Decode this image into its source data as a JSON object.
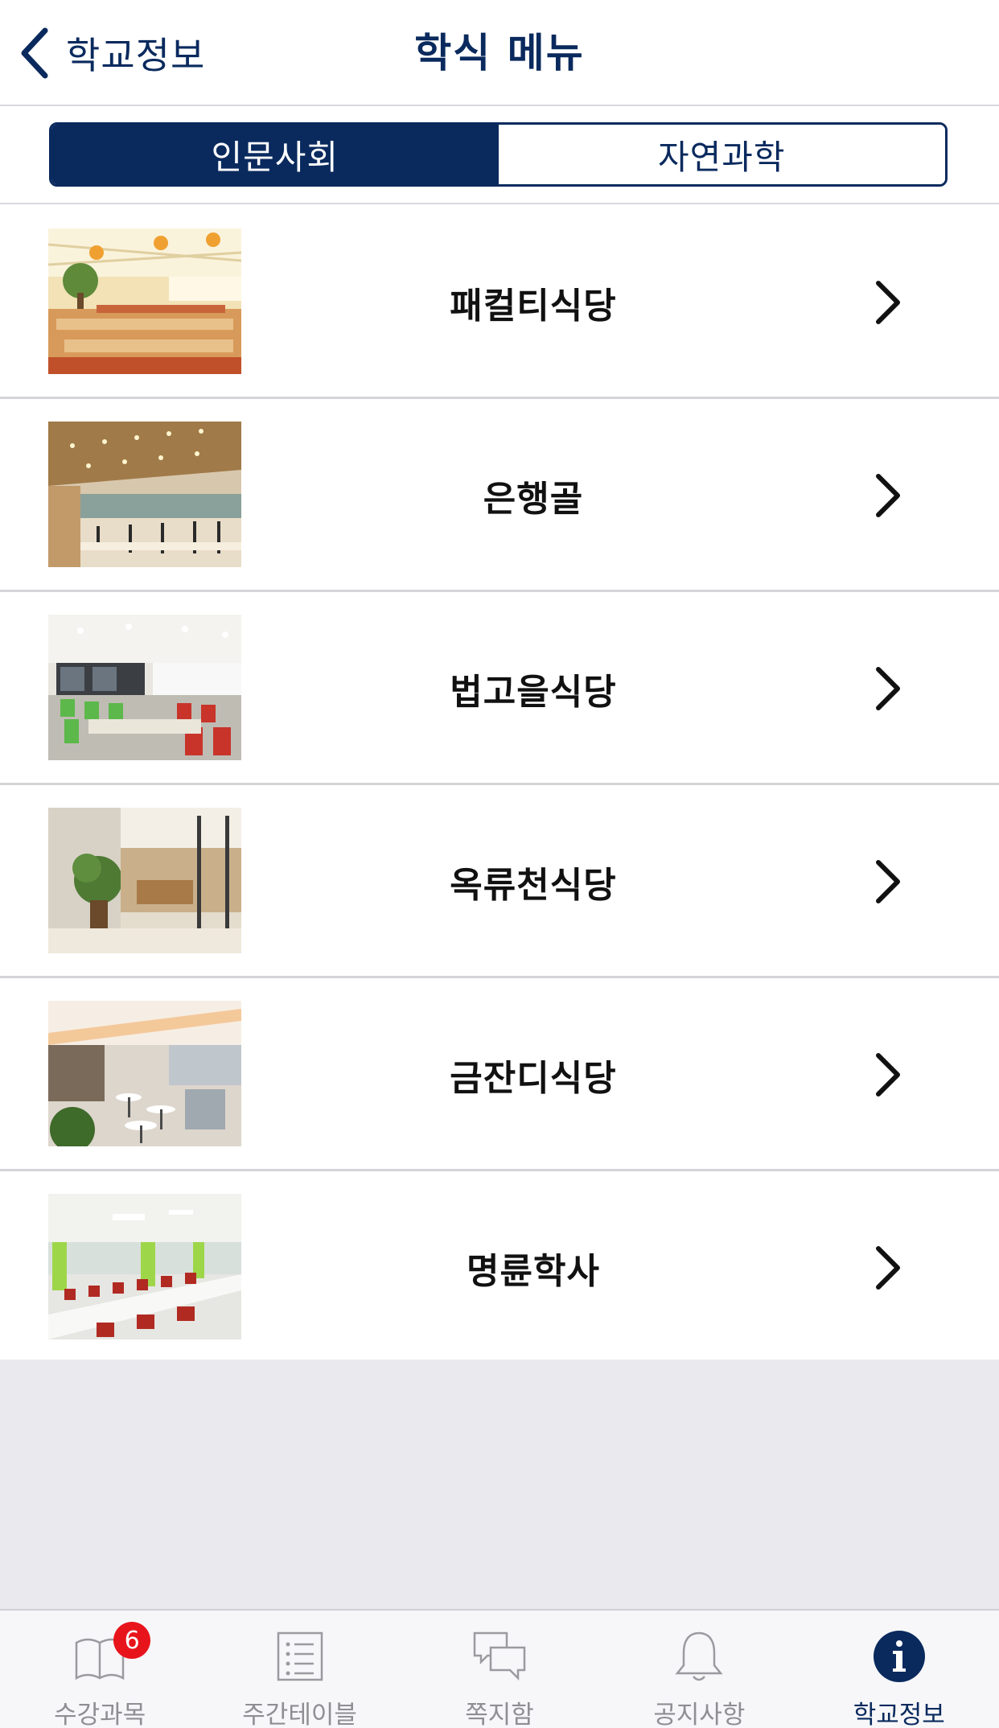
{
  "header": {
    "back_label": "학교정보",
    "title": "학식 메뉴"
  },
  "segments": [
    {
      "label": "인문사회",
      "selected": true
    },
    {
      "label": "자연과학",
      "selected": false
    }
  ],
  "restaurants": [
    {
      "name": "패컬티식당"
    },
    {
      "name": "은행골"
    },
    {
      "name": "법고을식당"
    },
    {
      "name": "옥류천식당"
    },
    {
      "name": "금잔디식당"
    },
    {
      "name": "명륜학사"
    }
  ],
  "tabbar": {
    "tabs": [
      {
        "label": "수강과목",
        "icon": "book-icon",
        "badge": "6"
      },
      {
        "label": "주간테이블",
        "icon": "list-icon"
      },
      {
        "label": "쪽지함",
        "icon": "chat-bubbles-icon"
      },
      {
        "label": "공지사항",
        "icon": "bell-icon"
      },
      {
        "label": "학교정보",
        "icon": "info-icon",
        "active": true
      }
    ]
  },
  "colors": {
    "primary": "#0a2a5e",
    "badge": "#e8141c",
    "inactive_tab": "#8e8e93",
    "filler": "#e9e9ee"
  }
}
